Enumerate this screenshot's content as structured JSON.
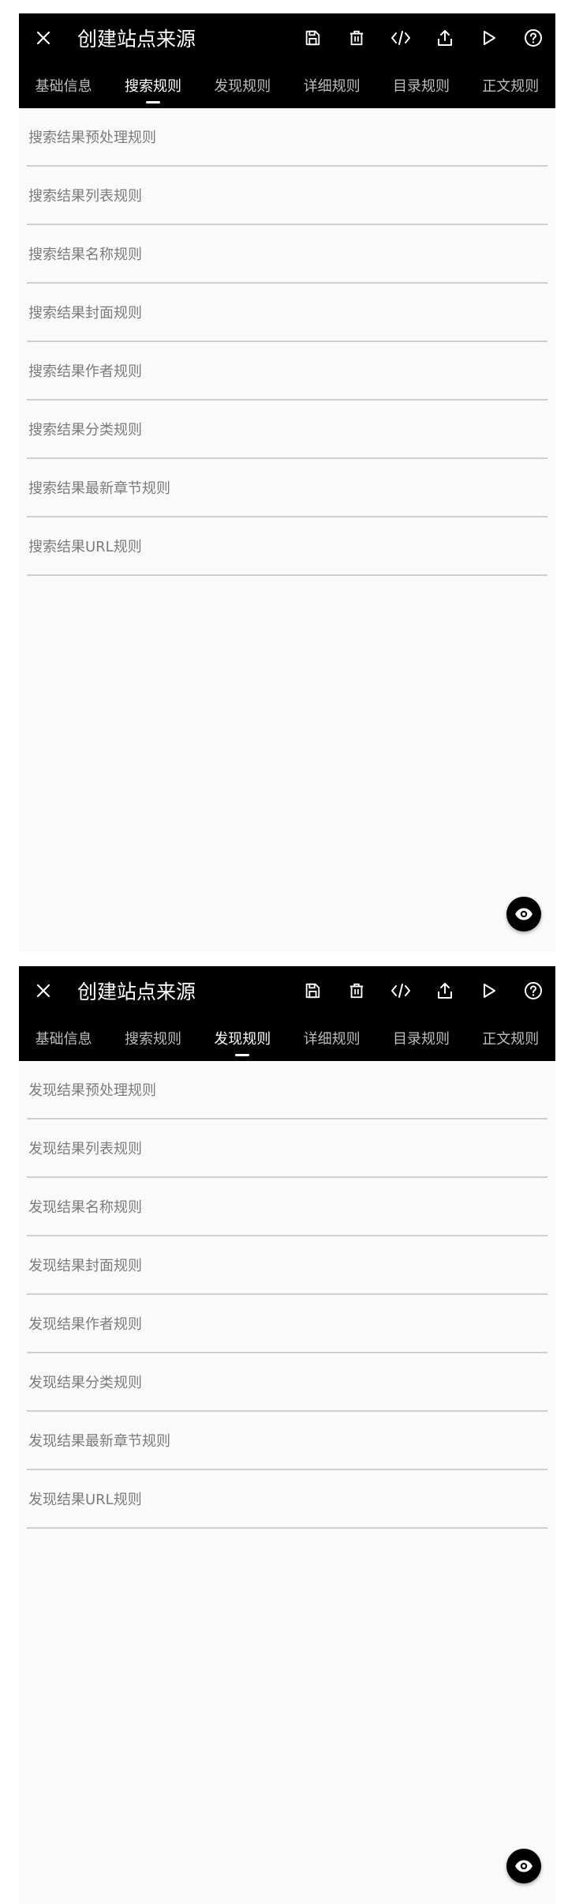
{
  "screens": [
    {
      "title": "创建站点来源",
      "tabs": [
        "基础信息",
        "搜索规则",
        "发现规则",
        "详细规则",
        "目录规则",
        "正文规则"
      ],
      "active_tab": "搜索规则",
      "rules": [
        "搜索结果预处理规则",
        "搜索结果列表规则",
        "搜索结果名称规则",
        "搜索结果封面规则",
        "搜索结果作者规则",
        "搜索结果分类规则",
        "搜索结果最新章节规则",
        "搜索结果URL规则"
      ]
    },
    {
      "title": "创建站点来源",
      "tabs": [
        "基础信息",
        "搜索规则",
        "发现规则",
        "详细规则",
        "目录规则",
        "正文规则"
      ],
      "active_tab": "发现规则",
      "rules": [
        "发现结果预处理规则",
        "发现结果列表规则",
        "发现结果名称规则",
        "发现结果封面规则",
        "发现结果作者规则",
        "发现结果分类规则",
        "发现结果最新章节规则",
        "发现结果URL规则"
      ]
    }
  ],
  "icons": {
    "close": "close-icon",
    "actions": [
      "save-icon",
      "delete-icon",
      "code-icon",
      "share-icon",
      "play-icon",
      "help-icon"
    ],
    "fab": "eye-icon"
  },
  "colors": {
    "appbar": "#000000",
    "background": "#fafafa",
    "tab_inactive": "#bdbdbd",
    "tab_active": "#ffffff",
    "rule_text": "#7b7b7b",
    "divider": "#cfcfcf"
  }
}
